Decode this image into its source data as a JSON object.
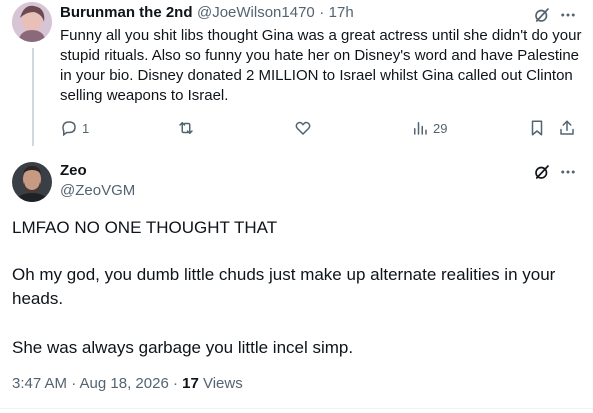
{
  "reply_tweet": {
    "display_name": "Burunman the 2nd",
    "handle": "@JoeWilson1470",
    "separator": "·",
    "time": "17h",
    "text": "Funny all you shit libs thought Gina was a great actress until she didn't do your stupid rituals. Also so funny you hate her on Disney's word and have Palestine in your bio. Disney donated 2 MILLION to Israel whilst Gina called out Clinton selling weapons to Israel.",
    "reply_count": "1",
    "views_count": "29",
    "icons": [
      "grok-icon",
      "more-icon",
      "reply-icon",
      "retweet-icon",
      "like-icon",
      "views-icon",
      "bookmark-icon",
      "share-icon"
    ]
  },
  "main_tweet": {
    "display_name": "Zeo",
    "handle": "@ZeoVGM",
    "paragraph1": "LMFAO NO ONE THOUGHT THAT",
    "paragraph2": "Oh my god, you dumb little chuds just make up alternate realities in your heads.",
    "paragraph3": "She was always garbage you little incel simp.",
    "timestamp": "3:47 AM · Aug 18, 2026 ·",
    "views_count": "17",
    "views_label": "Views",
    "icons": [
      "grok-icon",
      "more-icon"
    ]
  },
  "colors": {
    "text": "#0f1419",
    "muted": "#536471",
    "line": "#cfd9de",
    "divider": "#eff3f4"
  }
}
